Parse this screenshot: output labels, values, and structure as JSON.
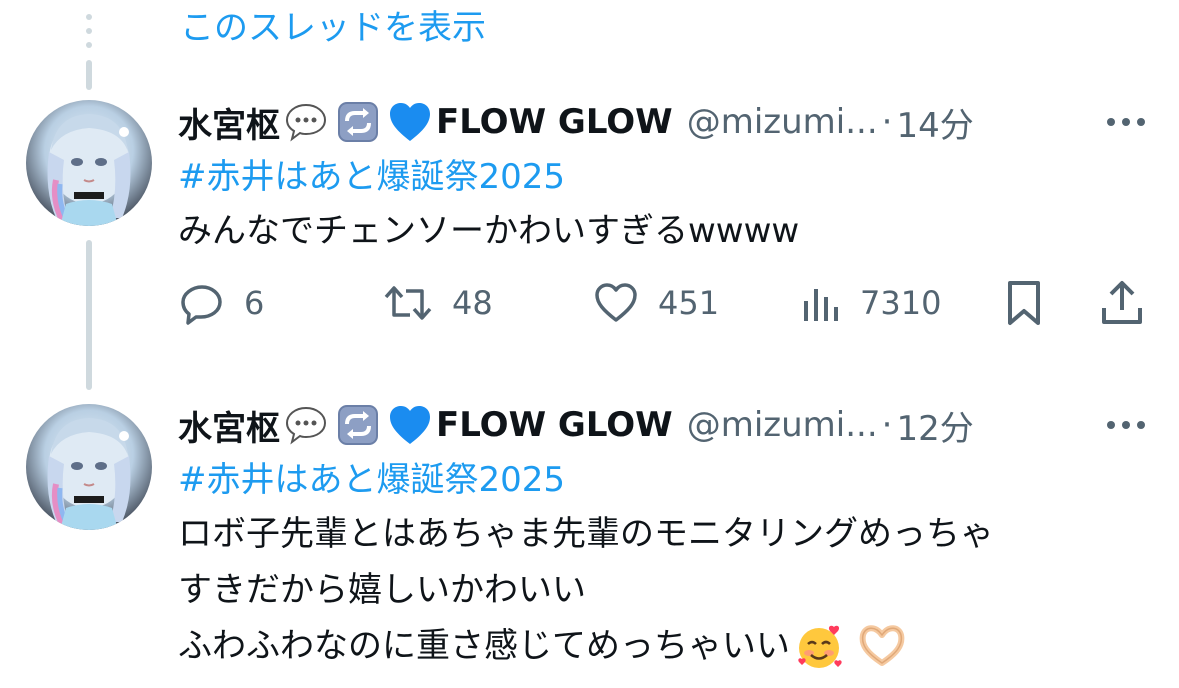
{
  "show_thread": {
    "label": "このスレッドを表示"
  },
  "colors": {
    "accent": "#1d9bf0",
    "text": "#0f1419",
    "secondary": "#536471",
    "thread_line": "#cfd9de"
  },
  "tweets": [
    {
      "display_name": "水宮枢",
      "name_emojis": [
        "speech-balloon-icon",
        "repeat-button-icon",
        "blue-heart-icon"
      ],
      "name_suffix": "FLOW GLOW",
      "handle": "@mizumi...",
      "separator": "·",
      "time": "14分",
      "hashtag": "#赤井はあと爆誕祭2025",
      "text_lines": [
        "みんなでチェンソーかわいすぎるwwww"
      ],
      "stats": {
        "replies": "6",
        "reposts": "48",
        "likes": "451",
        "views": "7310"
      }
    },
    {
      "display_name": "水宮枢",
      "name_emojis": [
        "speech-balloon-icon",
        "repeat-button-icon",
        "blue-heart-icon"
      ],
      "name_suffix": "FLOW GLOW",
      "handle": "@mizumi...",
      "separator": "·",
      "time": "12分",
      "hashtag": "#赤井はあと爆誕祭2025",
      "text_lines": [
        "ロボ子先輩とはあちゃま先輩のモニタリングめっちゃ",
        "すきだから嬉しいかわいい",
        "ふわふわなのに重さ感じてめっちゃいい"
      ],
      "trailing_emojis": [
        "smiling-face-with-hearts-icon",
        "heart-hands-icon"
      ]
    }
  ]
}
